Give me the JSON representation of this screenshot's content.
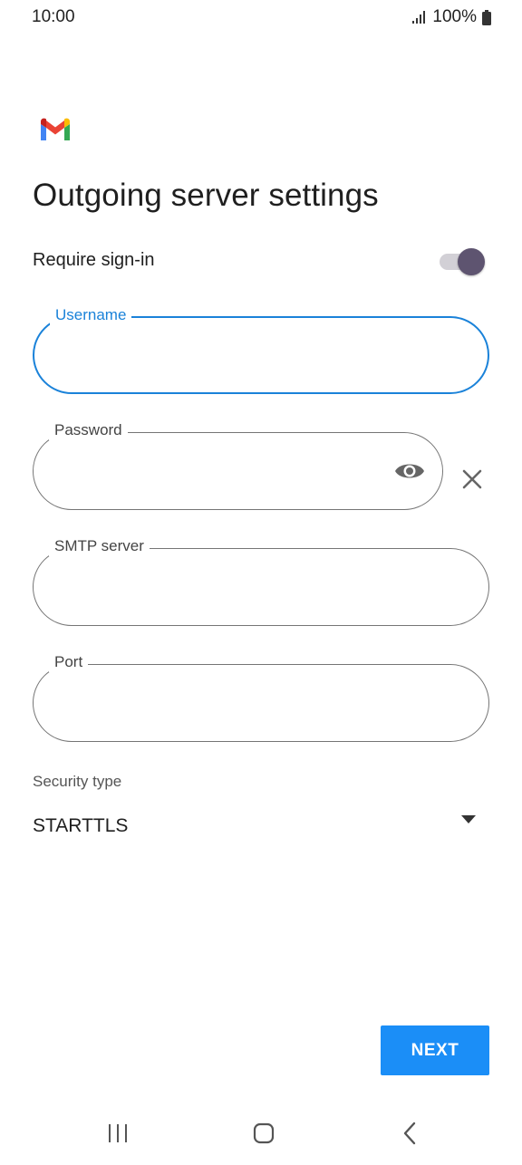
{
  "status_bar": {
    "time": "10:00",
    "battery": "100%",
    "icons": [
      "signal-icon",
      "battery-icon"
    ]
  },
  "app": {
    "logo": "gmail-logo",
    "title": "Outgoing server settings"
  },
  "require_signin": {
    "label": "Require sign-in",
    "enabled": true
  },
  "fields": {
    "username": {
      "label": "Username",
      "value": "",
      "focused": true
    },
    "password": {
      "label": "Password",
      "value": "",
      "icons": [
        "eye-icon",
        "close-icon"
      ]
    },
    "smtp_server": {
      "label": "SMTP server",
      "value": ""
    },
    "port": {
      "label": "Port",
      "value": ""
    }
  },
  "security": {
    "label": "Security type",
    "selected": "STARTTLS"
  },
  "actions": {
    "next_label": "NEXT"
  },
  "nav_bar": {
    "icons": [
      "recents-icon",
      "home-icon",
      "back-icon"
    ]
  },
  "colors": {
    "accent": "#1a82d9",
    "button": "#1b8ef7",
    "toggle_knob": "#5e5470",
    "toggle_track": "#d2d0d6"
  }
}
